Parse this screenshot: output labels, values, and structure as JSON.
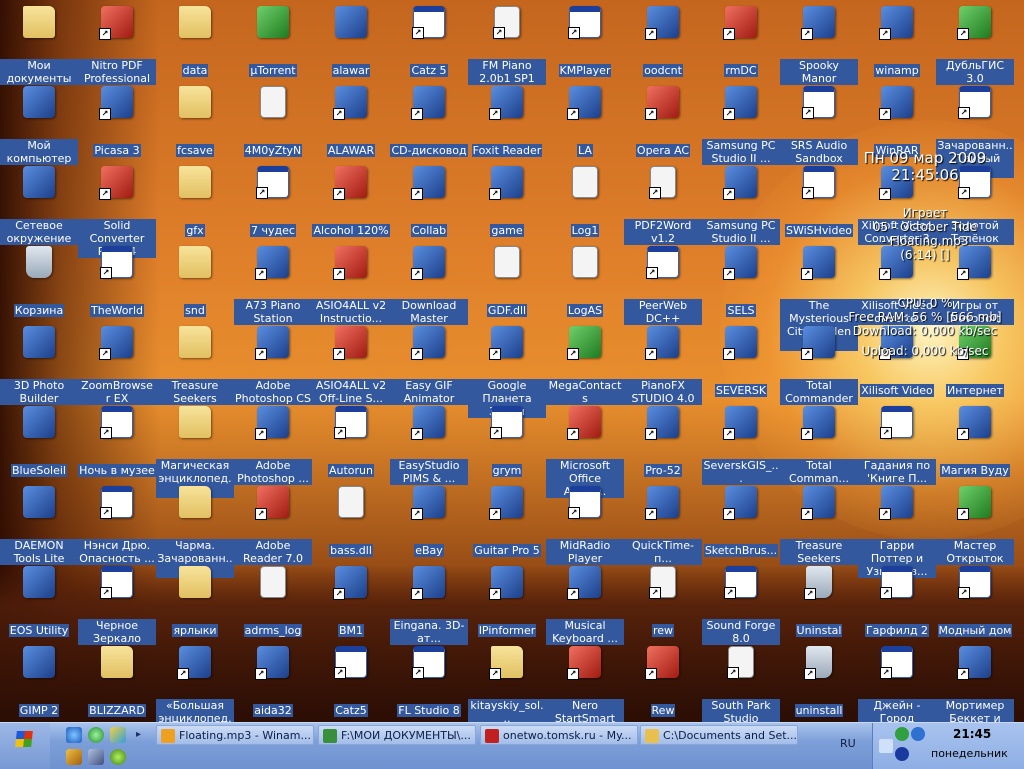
{
  "desktop": {
    "icons": [
      {
        "label": "Мои документы",
        "kind": "folder",
        "shortcut": false
      },
      {
        "label": "Nitro PDF Professional",
        "kind": "red",
        "shortcut": true
      },
      {
        "label": "data",
        "kind": "folder",
        "shortcut": false
      },
      {
        "label": "µTorrent",
        "kind": "green",
        "shortcut": false
      },
      {
        "label": "alawar",
        "kind": "app",
        "shortcut": false
      },
      {
        "label": "Catz 5",
        "kind": "win",
        "shortcut": true
      },
      {
        "label": "FM Piano 2.0b1 SP1",
        "kind": "doc",
        "shortcut": true
      },
      {
        "label": "KMPlayer",
        "kind": "win",
        "shortcut": true
      },
      {
        "label": "oodcnt",
        "kind": "app",
        "shortcut": true
      },
      {
        "label": "rmDC",
        "kind": "red",
        "shortcut": true
      },
      {
        "label": "Spooky Manor",
        "kind": "app",
        "shortcut": true
      },
      {
        "label": "winamp",
        "kind": "app",
        "shortcut": true
      },
      {
        "label": "ДубльГИС 3.0",
        "kind": "green",
        "shortcut": true
      },
      {
        "label": "Мой компьютер",
        "kind": "app",
        "shortcut": false
      },
      {
        "label": "Picasa 3",
        "kind": "app",
        "shortcut": true
      },
      {
        "label": "fcsave",
        "kind": "folder",
        "shortcut": false
      },
      {
        "label": "4M0yZtyN",
        "kind": "doc",
        "shortcut": false
      },
      {
        "label": "ALAWAR",
        "kind": "app",
        "shortcut": true
      },
      {
        "label": "CD-дисковод",
        "kind": "app",
        "shortcut": true
      },
      {
        "label": "Foxit Reader",
        "kind": "app",
        "shortcut": true
      },
      {
        "label": "LA",
        "kind": "app",
        "shortcut": true
      },
      {
        "label": "Opera AC",
        "kind": "red",
        "shortcut": true
      },
      {
        "label": "Samsung PC Studio II ...",
        "kind": "app",
        "shortcut": true
      },
      {
        "label": "SRS Audio Sandbox",
        "kind": "win",
        "shortcut": true
      },
      {
        "label": "WinRAR",
        "kind": "app",
        "shortcut": true
      },
      {
        "label": "Зачарованн... Тайный дог...",
        "kind": "win",
        "shortcut": true
      },
      {
        "label": "Сетевое окружение",
        "kind": "app",
        "shortcut": false
      },
      {
        "label": "Solid Converter PDF v4",
        "kind": "red",
        "shortcut": true
      },
      {
        "label": "gfx",
        "kind": "folder",
        "shortcut": false
      },
      {
        "label": "7 чудес",
        "kind": "win",
        "shortcut": true
      },
      {
        "label": "Alcohol 120%",
        "kind": "red",
        "shortcut": true
      },
      {
        "label": "Collab",
        "kind": "app",
        "shortcut": true
      },
      {
        "label": "game",
        "kind": "app",
        "shortcut": true
      },
      {
        "label": "Log1",
        "kind": "doc",
        "shortcut": false
      },
      {
        "label": "PDF2Word v1.2",
        "kind": "doc",
        "shortcut": true
      },
      {
        "label": "Samsung PC Studio II ...",
        "kind": "app",
        "shortcut": true
      },
      {
        "label": "SWiSHvideo",
        "kind": "win",
        "shortcut": true
      },
      {
        "label": "Xilisoft Video Converter 3",
        "kind": "app",
        "shortcut": true
      },
      {
        "label": "Золотой Телёнок",
        "kind": "win",
        "shortcut": true
      },
      {
        "label": "Корзина",
        "kind": "bin",
        "shortcut": false
      },
      {
        "label": "TheWorld",
        "kind": "win",
        "shortcut": true
      },
      {
        "label": "snd",
        "kind": "folder",
        "shortcut": false
      },
      {
        "label": "A73 Piano Station",
        "kind": "app",
        "shortcut": true
      },
      {
        "label": "ASIO4ALL v2 Instructio...",
        "kind": "red",
        "shortcut": true
      },
      {
        "label": "Download Master",
        "kind": "app",
        "shortcut": true
      },
      {
        "label": "GDF.dll",
        "kind": "doc",
        "shortcut": false
      },
      {
        "label": "LogAS",
        "kind": "doc",
        "shortcut": false
      },
      {
        "label": "PeerWeb DC++",
        "kind": "win",
        "shortcut": true
      },
      {
        "label": "SELS",
        "kind": "app",
        "shortcut": true
      },
      {
        "label": "The Mysterious City Golden ...",
        "kind": "app",
        "shortcut": true
      },
      {
        "label": "Xilisoft Video Converte...",
        "kind": "app",
        "shortcut": true
      },
      {
        "label": "Игры от NevoSoft",
        "kind": "app",
        "shortcut": true
      },
      {
        "label": "3D Photo Builder",
        "kind": "app",
        "shortcut": false
      },
      {
        "label": "ZoomBrowser EX",
        "kind": "app",
        "shortcut": true
      },
      {
        "label": "Treasure Seekers",
        "kind": "folder",
        "shortcut": false
      },
      {
        "label": "Adobe Photoshop CS",
        "kind": "app",
        "shortcut": true
      },
      {
        "label": "ASIO4ALL v2 Off-Line S...",
        "kind": "red",
        "shortcut": true
      },
      {
        "label": "Easy GIF Animator",
        "kind": "app",
        "shortcut": true
      },
      {
        "label": "Google Планета Земля",
        "kind": "app",
        "shortcut": true
      },
      {
        "label": "MegaContacts",
        "kind": "green",
        "shortcut": true
      },
      {
        "label": "PianoFX STUDIO 4.0",
        "kind": "app",
        "shortcut": true
      },
      {
        "label": "SEVERSK",
        "kind": "app",
        "shortcut": true
      },
      {
        "label": "Total Commander",
        "kind": "app",
        "shortcut": true
      },
      {
        "label": "Xilisoft Video",
        "kind": "app",
        "shortcut": true
      },
      {
        "label": "Интернет",
        "kind": "green",
        "shortcut": true
      },
      {
        "label": "BlueSoleil",
        "kind": "app",
        "shortcut": false
      },
      {
        "label": "Ночь в музее",
        "kind": "win",
        "shortcut": true
      },
      {
        "label": "Магическая энциклопед...",
        "kind": "folder",
        "shortcut": false
      },
      {
        "label": "Adobe Photoshop ...",
        "kind": "app",
        "shortcut": true
      },
      {
        "label": "Autorun",
        "kind": "win",
        "shortcut": true
      },
      {
        "label": "EasyStudio PIMS & ...",
        "kind": "app",
        "shortcut": true
      },
      {
        "label": "grym",
        "kind": "win",
        "shortcut": true
      },
      {
        "label": "Microsoft Office Acces...",
        "kind": "red",
        "shortcut": true
      },
      {
        "label": "Pro-52",
        "kind": "app",
        "shortcut": true
      },
      {
        "label": "SeverskGIS_...",
        "kind": "app",
        "shortcut": true
      },
      {
        "label": "Total Comman...",
        "kind": "app",
        "shortcut": true
      },
      {
        "label": "Гадания по 'Книге П...",
        "kind": "win",
        "shortcut": true
      },
      {
        "label": "Магия Вуду",
        "kind": "app",
        "shortcut": true
      },
      {
        "label": "DAEMON Tools Lite",
        "kind": "app",
        "shortcut": false
      },
      {
        "label": "Нэнси Дрю. Опасность ...",
        "kind": "win",
        "shortcut": true
      },
      {
        "label": "Чарма. Зачарованн...",
        "kind": "folder",
        "shortcut": false
      },
      {
        "label": "Adobe Reader 7.0",
        "kind": "red",
        "shortcut": true
      },
      {
        "label": "bass.dll",
        "kind": "doc",
        "shortcut": false
      },
      {
        "label": "eBay",
        "kind": "app",
        "shortcut": true
      },
      {
        "label": "Guitar Pro 5",
        "kind": "app",
        "shortcut": true
      },
      {
        "label": "MidRadio Player",
        "kind": "win",
        "shortcut": true
      },
      {
        "label": "QuickTime-п...",
        "kind": "app",
        "shortcut": true
      },
      {
        "label": "SketchBrus...",
        "kind": "app",
        "shortcut": true
      },
      {
        "label": "Treasure Seekers",
        "kind": "app",
        "shortcut": true
      },
      {
        "label": "Гарри Поттер и Узник Аз...",
        "kind": "app",
        "shortcut": true
      },
      {
        "label": "Мастер Открыток",
        "kind": "green",
        "shortcut": true
      },
      {
        "label": "EOS Utility",
        "kind": "app",
        "shortcut": false
      },
      {
        "label": "Черное Зеркало",
        "kind": "win",
        "shortcut": true
      },
      {
        "label": "ярлыки",
        "kind": "folder",
        "shortcut": false
      },
      {
        "label": "adrms_log",
        "kind": "doc",
        "shortcut": false
      },
      {
        "label": "BM1",
        "kind": "app",
        "shortcut": true
      },
      {
        "label": "Eingana. 3D-ат...",
        "kind": "app",
        "shortcut": true
      },
      {
        "label": "IPinformer",
        "kind": "app",
        "shortcut": true
      },
      {
        "label": "Musical Keyboard ...",
        "kind": "app",
        "shortcut": true
      },
      {
        "label": "rew",
        "kind": "doc",
        "shortcut": true
      },
      {
        "label": "Sound Forge 8.0",
        "kind": "win",
        "shortcut": true
      },
      {
        "label": "Uninstal",
        "kind": "bin",
        "shortcut": true
      },
      {
        "label": "Гарфилд 2",
        "kind": "win",
        "shortcut": true
      },
      {
        "label": "Модный дом",
        "kind": "win",
        "shortcut": true
      },
      {
        "label": "GIMP 2",
        "kind": "app",
        "shortcut": false
      },
      {
        "label": "BLIZZARD",
        "kind": "folder",
        "shortcut": false
      },
      {
        "label": "«Большая энциклопед...",
        "kind": "app",
        "shortcut": true
      },
      {
        "label": "aida32",
        "kind": "app",
        "shortcut": true
      },
      {
        "label": "Catz5",
        "kind": "win",
        "shortcut": true
      },
      {
        "label": "FL Studio 8",
        "kind": "win",
        "shortcut": true
      },
      {
        "label": "kitayskiy_sol...",
        "kind": "folder",
        "shortcut": true
      },
      {
        "label": "Nero StartSmart",
        "kind": "red",
        "shortcut": true
      },
      {
        "label": "Rew",
        "kind": "red",
        "shortcut": true
      },
      {
        "label": "South Park Studio",
        "kind": "doc",
        "shortcut": true
      },
      {
        "label": "uninstall",
        "kind": "bin",
        "shortcut": true
      },
      {
        "label": "Джейн - Город Мечты",
        "kind": "win",
        "shortcut": true
      },
      {
        "label": "Мортимер Беккет и та...",
        "kind": "app",
        "shortcut": true
      }
    ]
  },
  "overlay": {
    "date": "Пн 09 мар 2009",
    "time": "21:45:06",
    "playing_label": "Играет",
    "track_line1": "05 - October Tide",
    "track_line2": "- Floating.mp3",
    "track_time": "(6:14) []",
    "cpu": "CPU: 0 %",
    "ram": "Free RAM: 56 % [566 mb]",
    "download": "Download: 0,000 kb/sec",
    "upload": "Upload: 0,000 kb/sec"
  },
  "taskbar": {
    "tasks": [
      {
        "label": "Floating.mp3 - Winam...",
        "color": "#f0a020"
      },
      {
        "label": "F:\\МОИ ДОКУМЕНТЫ\\...",
        "color": "#3a8f3a"
      },
      {
        "label": "onetwo.tomsk.ru - My...",
        "color": "#c02020"
      },
      {
        "label": "C:\\Documents and Set...",
        "color": "#e8c050"
      }
    ],
    "language": "RU",
    "clock_time": "21:45",
    "clock_day": "понедельник"
  },
  "colors": {
    "label_bg": "#33589d",
    "taskbar": "#7d9fd8"
  }
}
